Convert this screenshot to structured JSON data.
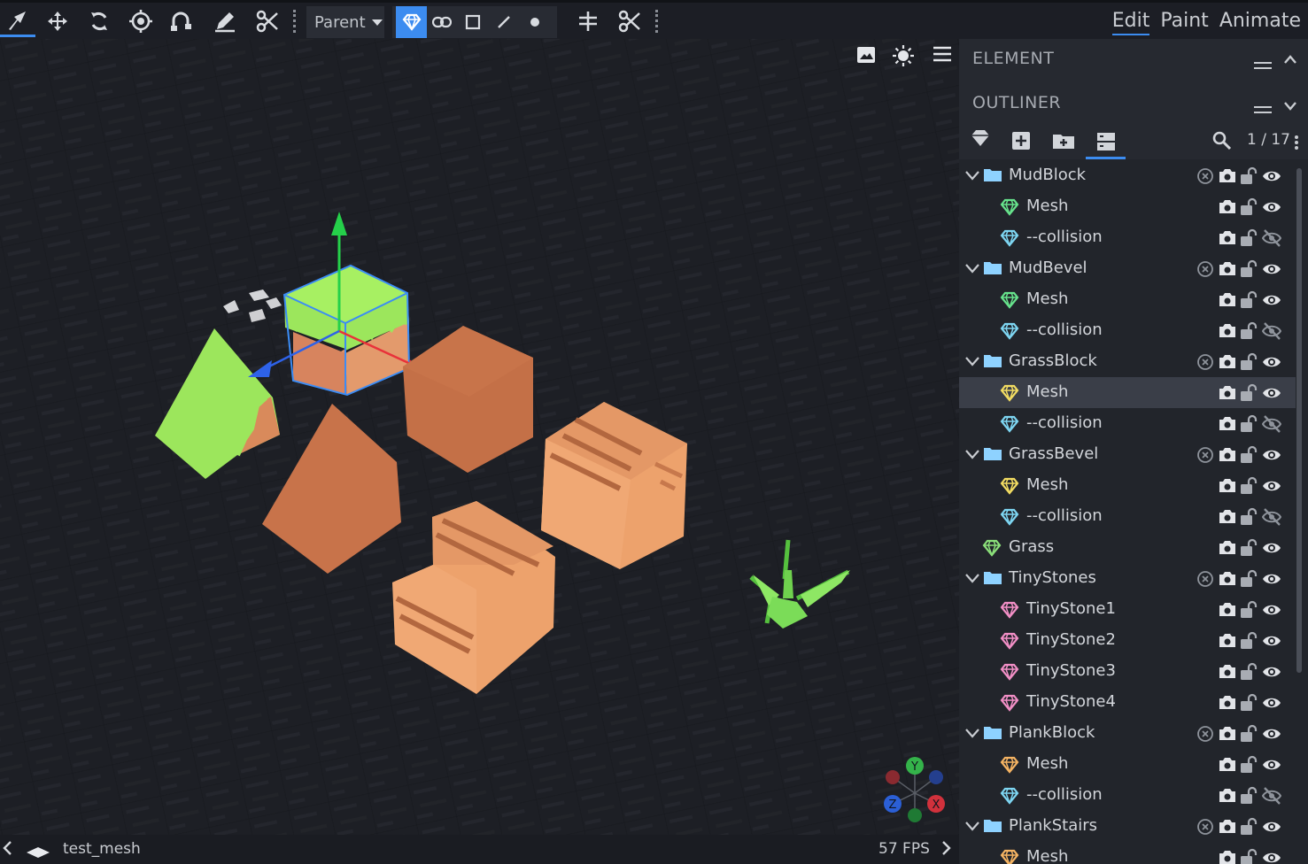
{
  "toolbar": {
    "transform_space": "Parent",
    "modes": [
      {
        "label": "Edit",
        "active": true
      },
      {
        "label": "Paint",
        "active": false
      },
      {
        "label": "Animate",
        "active": false
      }
    ]
  },
  "panels": {
    "element_title": "ELEMENT",
    "outliner_title": "OUTLINER",
    "selection_count": "1 / 17"
  },
  "outliner": [
    {
      "label": "MudBlock",
      "type": "group",
      "depth": 0,
      "mesh_color": "#8ec5ff",
      "visible": true
    },
    {
      "label": "Mesh",
      "type": "mesh",
      "depth": 1,
      "gem_color": "#67e38c",
      "visible": true
    },
    {
      "label": "--collision",
      "type": "mesh",
      "depth": 1,
      "gem_color": "#7ed6f2",
      "visible": false
    },
    {
      "label": "MudBevel",
      "type": "group",
      "depth": 0,
      "visible": true
    },
    {
      "label": "Mesh",
      "type": "mesh",
      "depth": 1,
      "gem_color": "#67e38c",
      "visible": true
    },
    {
      "label": "--collision",
      "type": "mesh",
      "depth": 1,
      "gem_color": "#7ed6f2",
      "visible": false
    },
    {
      "label": "GrassBlock",
      "type": "group",
      "depth": 0,
      "visible": true
    },
    {
      "label": "Mesh",
      "type": "mesh",
      "depth": 1,
      "gem_color": "#f2dc62",
      "visible": true,
      "selected": true
    },
    {
      "label": "--collision",
      "type": "mesh",
      "depth": 1,
      "gem_color": "#7ed6f2",
      "visible": false
    },
    {
      "label": "GrassBevel",
      "type": "group",
      "depth": 0,
      "visible": true
    },
    {
      "label": "Mesh",
      "type": "mesh",
      "depth": 1,
      "gem_color": "#f2dc62",
      "visible": true
    },
    {
      "label": "--collision",
      "type": "mesh",
      "depth": 1,
      "gem_color": "#7ed6f2",
      "visible": false
    },
    {
      "label": "Grass",
      "type": "mesh",
      "depth": 0,
      "gem_color": "#8be07a",
      "visible": true
    },
    {
      "label": "TinyStones",
      "type": "group",
      "depth": 0,
      "visible": true
    },
    {
      "label": "TinyStone1",
      "type": "mesh",
      "depth": 1,
      "gem_color": "#f28fc6",
      "visible": true
    },
    {
      "label": "TinyStone2",
      "type": "mesh",
      "depth": 1,
      "gem_color": "#f28fc6",
      "visible": true
    },
    {
      "label": "TinyStone3",
      "type": "mesh",
      "depth": 1,
      "gem_color": "#f28fc6",
      "visible": true
    },
    {
      "label": "TinyStone4",
      "type": "mesh",
      "depth": 1,
      "gem_color": "#f28fc6",
      "visible": true
    },
    {
      "label": "PlankBlock",
      "type": "group",
      "depth": 0,
      "visible": true
    },
    {
      "label": "Mesh",
      "type": "mesh",
      "depth": 1,
      "gem_color": "#f5b463",
      "visible": true
    },
    {
      "label": "--collision",
      "type": "mesh",
      "depth": 1,
      "gem_color": "#7ed6f2",
      "visible": false
    },
    {
      "label": "PlankStairs",
      "type": "group",
      "depth": 0,
      "visible": true
    },
    {
      "label": "Mesh",
      "type": "mesh",
      "depth": 1,
      "gem_color": "#f5b463",
      "visible": true
    }
  ],
  "status": {
    "project_name": "test_mesh",
    "fps": "57 FPS"
  },
  "gizmo_axes": {
    "y": "Y",
    "z": "Z",
    "x": "X"
  },
  "colors": {
    "accent": "#3c8cf0",
    "folder": "#8ed2ff",
    "selected_row": "#3a3e48"
  }
}
